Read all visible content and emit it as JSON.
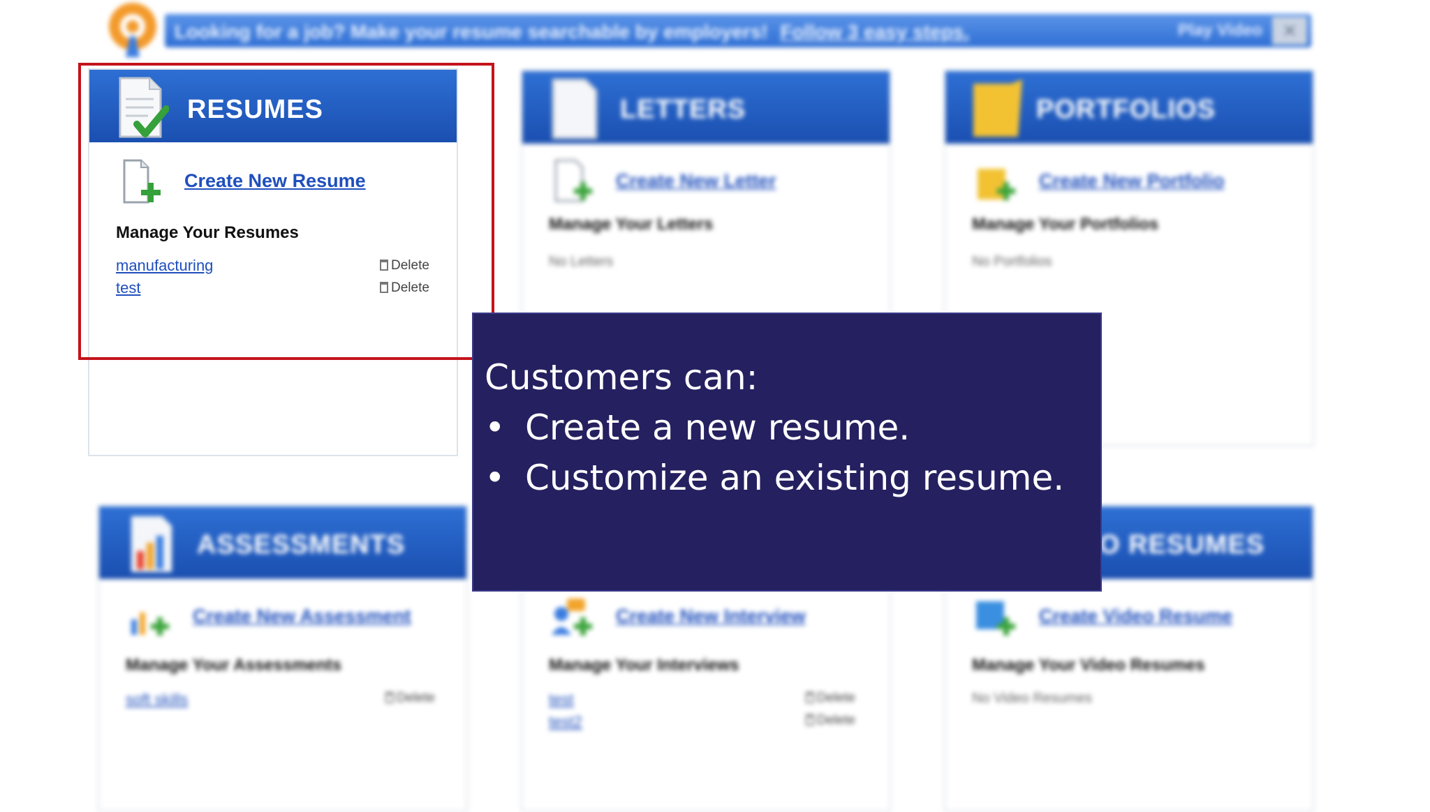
{
  "banner": {
    "text": "Looking for a job? Make your resume searchable by employers!",
    "link": "Follow 3 easy steps.",
    "right": "Play Video",
    "close": "×"
  },
  "cards": {
    "resumes": {
      "title": "RESUMES",
      "create": "Create New Resume",
      "manage": "Manage Your Resumes",
      "items": [
        {
          "name": "manufacturing",
          "action": "Delete"
        },
        {
          "name": "test",
          "action": "Delete"
        }
      ]
    },
    "letters": {
      "title": "LETTERS",
      "create": "Create New Letter",
      "manage": "Manage Your Letters",
      "empty": "No Letters"
    },
    "portfolios": {
      "title": "PORTFOLIOS",
      "create": "Create New Portfolio",
      "manage": "Manage Your Portfolios",
      "empty": "No Portfolios"
    },
    "assessments": {
      "title": "ASSESSMENTS",
      "create": "Create New Assessment",
      "manage": "Manage Your Assessments",
      "items": [
        {
          "name": "soft skills",
          "action": "Delete"
        }
      ]
    },
    "interviews": {
      "create": "Create New Interview",
      "manage": "Manage Your Interviews",
      "items": [
        {
          "name": "test",
          "action": "Delete"
        },
        {
          "name": "test2",
          "action": "Delete"
        }
      ]
    },
    "video": {
      "title": "O RESUMES",
      "create": "Create Video Resume",
      "manage": "Manage Your Video Resumes",
      "empty": "No Video Resumes"
    }
  },
  "caption": {
    "heading": "Customers can:",
    "bullets": [
      "Create a new resume.",
      "Customize an existing resume."
    ],
    "bullet_char": "•"
  },
  "colors": {
    "header_blue": "#2e6fd4",
    "highlight_red": "#c4121b",
    "caption_bg": "#25205f",
    "link_blue": "#1f4fbd"
  },
  "icons": [
    "resume-check-icon",
    "add-document-icon",
    "letter-icon",
    "folder-icon",
    "chart-icon",
    "interview-icon",
    "video-icon",
    "trash-icon",
    "logo-icon"
  ]
}
